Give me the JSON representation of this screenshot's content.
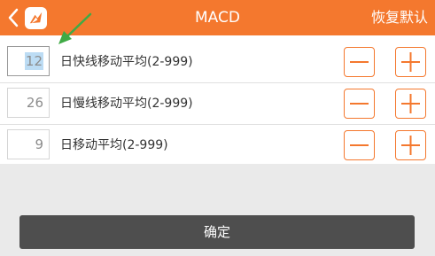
{
  "header": {
    "title": "MACD",
    "reset_label": "恢复默认"
  },
  "params": [
    {
      "value": "12",
      "label": "日快线移动平均(2-999)"
    },
    {
      "value": "26",
      "label": "日慢线移动平均(2-999)"
    },
    {
      "value": "9",
      "label": "日移动平均(2-999)"
    }
  ],
  "icons": {
    "back": "chevron-left-icon",
    "logo": "app-logo-icon",
    "minus": "minus-icon",
    "plus": "plus-icon",
    "hint": "hint-arrow-icon"
  },
  "colors": {
    "accent": "#f4782e",
    "background": "#eaeaea",
    "confirm_button": "#4e4e4e",
    "selection": "#bcdcf4",
    "hint_arrow": "#3faa45"
  },
  "confirm_label": "确定"
}
